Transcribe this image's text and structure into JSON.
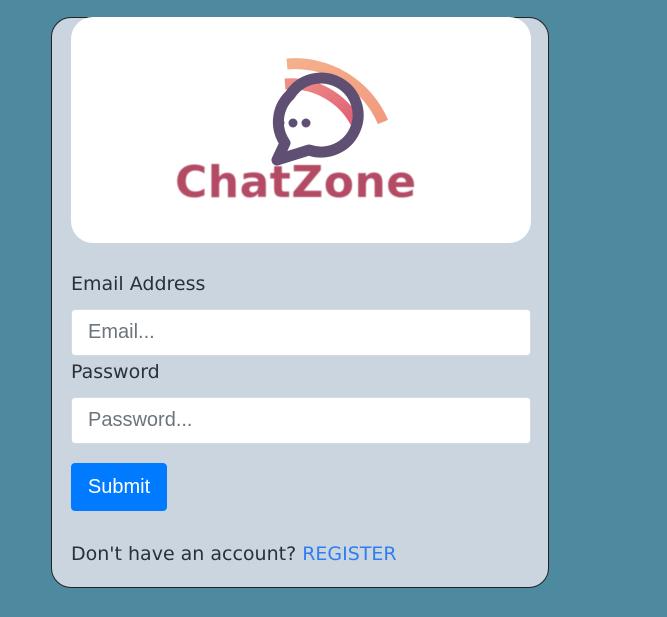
{
  "logo": {
    "brand_name": "ChatZone",
    "icon": "chat-bubble-signal-icon",
    "colors": {
      "bubble": "#5e4f73",
      "wave_inner": "#e56b78",
      "wave_outer": "#f4b08c",
      "text": "#b34b64"
    }
  },
  "form": {
    "email_label": "Email Address",
    "email_placeholder": "Email...",
    "email_value": "",
    "password_label": "Password",
    "password_placeholder": "Password...",
    "password_value": "",
    "submit_label": "Submit"
  },
  "footer": {
    "prompt_text": "Don't have an account?",
    "register_label": "REGISTER"
  },
  "colors": {
    "page_background": "#4d8aa0",
    "card_background": "#cbd5e0",
    "primary_button": "#007bff",
    "link": "#2f7ef0"
  }
}
